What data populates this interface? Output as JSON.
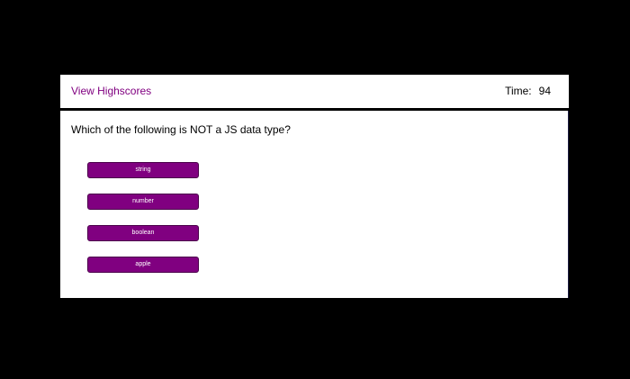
{
  "header": {
    "highscores_label": "View Highscores",
    "timer_label": "Time:",
    "timer_value": "94"
  },
  "quiz": {
    "question": "Which of the following is NOT a JS data type?",
    "choices": [
      {
        "label": "string"
      },
      {
        "label": "number"
      },
      {
        "label": "boolean"
      },
      {
        "label": "apple"
      }
    ]
  },
  "colors": {
    "background": "#000000",
    "card": "#ffffff",
    "accent": "#800080",
    "button_text": "#ffffff"
  }
}
